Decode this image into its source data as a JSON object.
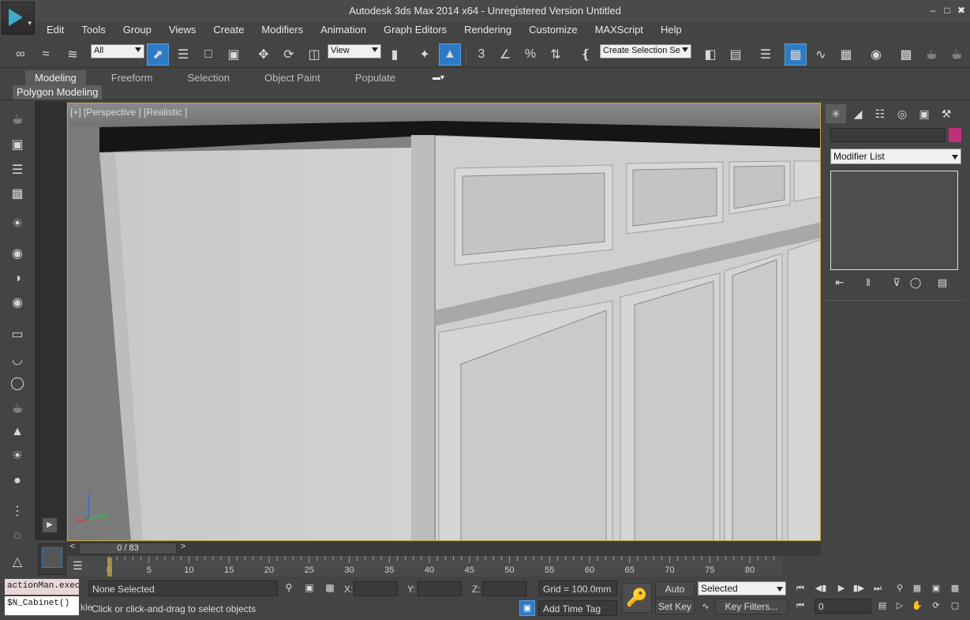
{
  "window": {
    "title": "Autodesk 3ds Max  2014 x64  - Unregistered Version    Untitled",
    "controls": [
      "–",
      "□",
      "✖"
    ]
  },
  "menu": [
    "Edit",
    "Tools",
    "Group",
    "Views",
    "Create",
    "Modifiers",
    "Animation",
    "Graph Editors",
    "Rendering",
    "Customize",
    "MAXScript",
    "Help"
  ],
  "toolbar": {
    "filter_value": "All",
    "coord_value": "View",
    "selection_set_placeholder": "Create Selection Se",
    "snap_label": "3",
    "percent_label": "%"
  },
  "ribbon": {
    "tabs": [
      "Modeling",
      "Freeform",
      "Selection",
      "Object Paint",
      "Populate"
    ],
    "active_tab": "Modeling",
    "panel_label": "Polygon Modeling"
  },
  "viewport": {
    "label": "[+] [Perspective ] [Realistic ]",
    "axis_x": "x",
    "axis_y": "y",
    "axis_z": "z"
  },
  "command_panel": {
    "modifier_list_label": "Modifier List",
    "object_color": "#c0307a"
  },
  "timeline": {
    "frame_display": "0 / 83",
    "prev": "<",
    "next": ">",
    "ticks": [
      "0",
      "5",
      "10",
      "15",
      "20",
      "25",
      "30",
      "35",
      "40",
      "45",
      "50",
      "55",
      "60",
      "65",
      "70",
      "75",
      "80"
    ]
  },
  "status": {
    "maxscript_line1": "actionMan.execu",
    "maxscript_line2": "$N_Cabinet()",
    "trunc_text": "kle",
    "selection": "None Selected",
    "x_label": "X:",
    "y_label": "Y:",
    "z_label": "Z:",
    "grid": "Grid = 100.0mm",
    "prompt": "Click or click-and-drag to select objects",
    "add_time_tag": "Add Time Tag",
    "auto_key": "Auto Key",
    "set_key": "Set Key",
    "key_mode": "Selected",
    "key_filters": "Key Filters...",
    "current_frame": "0"
  }
}
